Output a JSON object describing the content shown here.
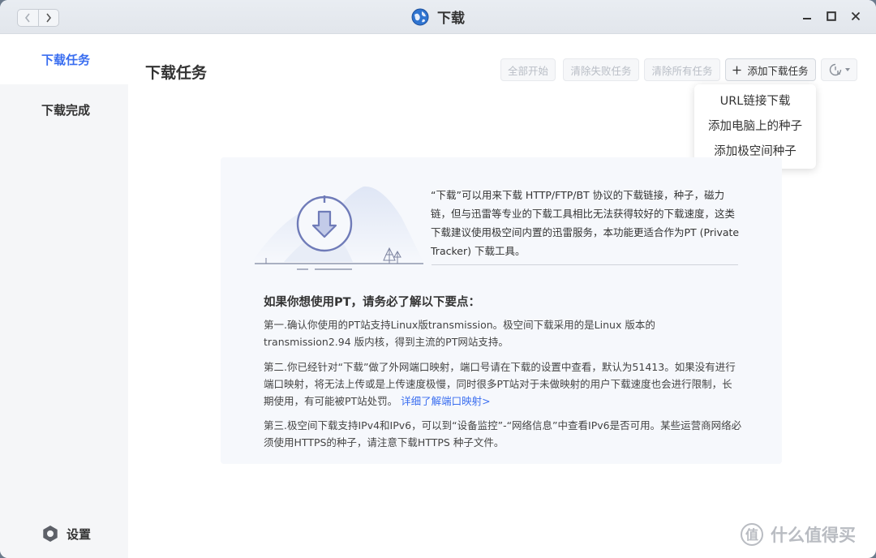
{
  "window": {
    "title": "下载"
  },
  "sidebar": {
    "items": [
      {
        "label": "下载任务",
        "active": true
      },
      {
        "label": "下载完成",
        "active": false
      }
    ],
    "settings_label": "设置"
  },
  "main": {
    "title": "下载任务",
    "toolbar": {
      "start_all": "全部开始",
      "clear_failed": "清除失败任务",
      "clear_all": "清除所有任务",
      "add_task": "添加下载任务"
    },
    "dropdown": [
      "URL链接下载",
      "添加电脑上的种子",
      "添加极空间种子"
    ]
  },
  "info": {
    "description": "“下载”可以用来下载 HTTP/FTP/BT 协议的下载链接，种子，磁力链，但与迅雷等专业的下载工具相比无法获得较好的下载速度，这类下载建议使用极空间内置的迅雷服务，本功能更适合作为PT (Private Tracker) 下载工具。",
    "heading": "如果你想使用PT，请务必了解以下要点：",
    "p1": "第一.确认你使用的PT站支持Linux版transmission。极空间下载采用的是Linux 版本的 transmission2.94 版内核，得到主流的PT网站支持。",
    "p2": "第二.你已经针对“下载”做了外网端口映射，端口号请在下载的设置中查看，默认为51413。如果没有进行端口映射，将无法上传或是上传速度极慢，同时很多PT站对于未做映射的用户下载速度也会进行限制，长期使用，有可能被PT站处罚。",
    "p2_link": "详细了解端口映射>",
    "p3": "第三.极空间下载支持IPv4和IPv6，可以到“设备监控”-“网络信息”中查看IPv6是否可用。某些运营商网络必须使用HTTPS的种子，请注意下载HTTPS 种子文件。"
  },
  "watermark": {
    "text": "什么值得买",
    "badge": "值"
  },
  "colors": {
    "accent": "#3a6ef0",
    "sidebar_bg": "#f5f6f8",
    "card_bg": "#f6f8fc"
  }
}
